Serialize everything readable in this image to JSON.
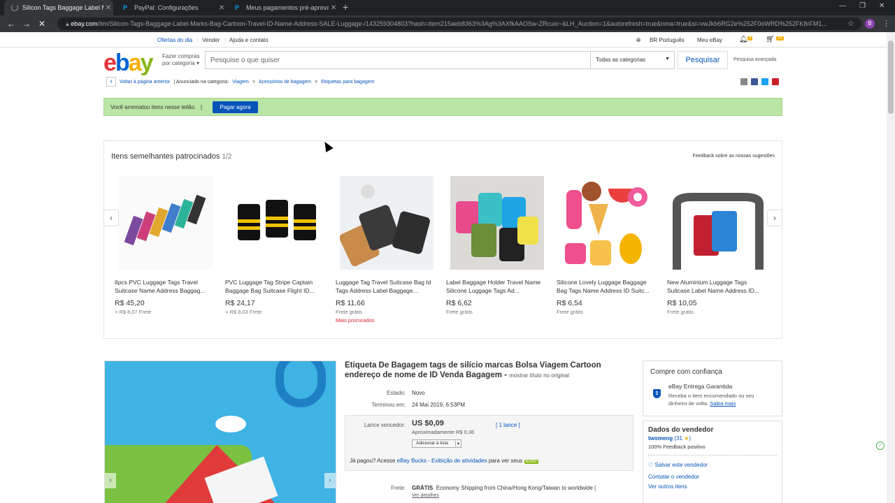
{
  "browser": {
    "tabs": [
      {
        "title": "Silicon Tags Baggage Label Mark",
        "active": true
      },
      {
        "title": "PayPal: Configurações",
        "active": false
      },
      {
        "title": "Meus pagamentos pré-aprovados",
        "active": false
      }
    ],
    "url_domain": "ebay.com",
    "url_path": "/itm/Silicon-Tags-Baggage-Label-Marks-Bag-Cartoon-Travel-ID-Name-Address-SALE-Luggage-/143259304803?hash=item215aeb8363%3Ag%3AXfkAAOSw-ZRcuio~&LH_Auction=1&autorefresh=true&nma=true&si=vwJkb6RG2e%252F0oWRD%252FK8rFM1...",
    "profile_initial": "B"
  },
  "topnav": {
    "deals": "Ofertas do dia",
    "sell": "Vender",
    "help": "Ajuda e contato",
    "language": "BR Português",
    "my_ebay": "Meu eBay",
    "notif_count": "3",
    "cart_count": "31"
  },
  "header": {
    "logo": [
      "e",
      "b",
      "a",
      "y"
    ],
    "shop_by_1": "Fazer compras",
    "shop_by_2": "por categoria",
    "search_placeholder": "Pesquise o que quiser",
    "category": "Todas as categorias",
    "search_btn": "Pesquisar",
    "advanced": "Pesquisa avançada"
  },
  "breadcrumb": {
    "back": "Voltar à página anterior",
    "listed_in": "| Anunciado na categoria:",
    "items": [
      "Viagem",
      "Acessórios de bagagem",
      "Etiquetas para bagagem"
    ]
  },
  "banner": {
    "message": "Você arrematou itens nesse leilão.",
    "sep": "|",
    "button": "Pagar agora"
  },
  "similar": {
    "title": "Itens semelhantes patrocinados",
    "page": "1/2",
    "feedback": "Feedback sobre as nossas sugestões",
    "items": [
      {
        "title": "6pcs PVC Luggage Tags Travel Suitcase Name Address Baggag...",
        "price": "R$ 45,20",
        "shipping": "+ R$ 8,07 Frete",
        "hot": ""
      },
      {
        "title": "PVC Luggage Tag Stripe Captain Baggage Bag Suitcase Flight ID...",
        "price": "R$ 24,17",
        "shipping": "+ R$ 8,03 Frete",
        "hot": ""
      },
      {
        "title": "Luggage Tag Travel Suitcase Bag Id Tags Address Label Baggage...",
        "price": "R$ 11,66",
        "shipping": "Frete grátis",
        "hot": "Mais procurados"
      },
      {
        "title": "Label Baggage Holder Travel Name Silicone Luggage Tags Ad...",
        "price": "R$ 6,62",
        "shipping": "Frete grátis",
        "hot": ""
      },
      {
        "title": "Silicone Lovely Luggage Baggage Bag Tags Name Address ID Suitc...",
        "price": "R$ 6,54",
        "shipping": "Frete grátis",
        "hot": ""
      },
      {
        "title": "New Aluminium Luggage Tags Suitcase Label Name Address ID...",
        "price": "R$ 10,05",
        "shipping": "Frete grátis",
        "hot": ""
      }
    ]
  },
  "product": {
    "title": "Etiqueta De Bagagem tags de silício marcas Bolsa Viagem Cartoon endereço de nome de ID Venda Bagagem -",
    "show_original": "mostrar título no original",
    "condition_label": "Estado:",
    "condition": "Novo",
    "ended_label": "Terminou em:",
    "ended": "24 Mai 2019, 6:53PM",
    "bid_label": "Lance vencedor:",
    "bid_price": "US $0,09",
    "bid_approx": "Aproximadamente R$ 0,36",
    "bid_count": "[ 1 lance ]",
    "watch": "Adicionar à lista",
    "bucks_prefix": "Já pagou? Acesse",
    "bucks_link": "eBay Bucks - Exibição de atividades",
    "bucks_suffix": "para ver seus",
    "bucks_logo": "Bucks",
    "shipping_label": "Frete:",
    "shipping_free": "GRÁTIS",
    "shipping_text": "Economy Shipping from China/Hong Kong/Taiwan to worldwide |",
    "shipping_details": "Ver detalhes"
  },
  "guarantee": {
    "title": "Compre com confiança",
    "name": "eBay Entrega Garantida",
    "desc1": "Receba o item encomendado ou seu",
    "desc2": "dinheiro de volta.",
    "more": "Saiba mais"
  },
  "seller": {
    "title": "Dados do vendedor",
    "name": "twomeng",
    "score": "(31",
    "score_end": ")",
    "feedback": "100% Feedback positivo",
    "save": "Salvar este vendedor",
    "contact": "Contatar o vendedor",
    "other": "Ver outros itens"
  },
  "colors": {
    "ebay_blue": "#0654ba",
    "banner_green": "#b9e5a5",
    "hot_red": "#dd1e31"
  }
}
